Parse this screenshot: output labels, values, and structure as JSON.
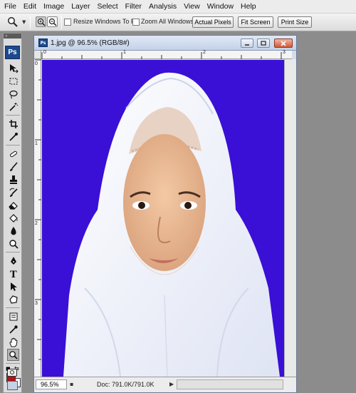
{
  "menu": [
    "File",
    "Edit",
    "Image",
    "Layer",
    "Select",
    "Filter",
    "Analysis",
    "View",
    "Window",
    "Help"
  ],
  "options_bar": {
    "active_tool_icon": "zoom-tool-icon",
    "resize_windows_label": "Resize Windows To Fit",
    "zoom_all_label": "Zoom All Windows",
    "actual_pixels_label": "Actual Pixels",
    "fit_screen_label": "Fit Screen",
    "print_size_label": "Print Size",
    "resize_windows_checked": false,
    "zoom_all_checked": false
  },
  "toolbox": {
    "logo": "Ps",
    "foreground_color": "#b01515",
    "background_color": "#ffffff"
  },
  "document": {
    "title": "1.jpg @ 96.5% (RGB/8#)",
    "ruler_top": [
      "0",
      "1",
      "2",
      "3"
    ],
    "ruler_left": [
      "0",
      "1",
      "2",
      "3"
    ],
    "canvas_background": "#3a0fd6",
    "zoom": "96.5%",
    "doc_info": "Doc: 791.0K/791.0K"
  }
}
